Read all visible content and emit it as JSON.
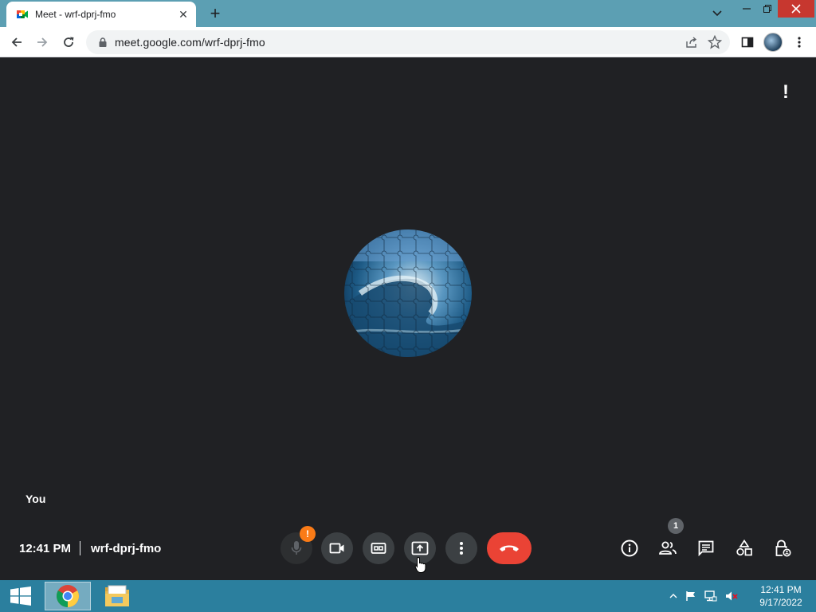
{
  "browser": {
    "tab_title": "Meet - wrf-dprj-fmo",
    "url": "meet.google.com/wrf-dprj-fmo"
  },
  "meet": {
    "participant_label": "You",
    "time": "12:41 PM",
    "meeting_code": "wrf-dprj-fmo",
    "mic_warning": "!",
    "people_count": "1",
    "colors": {
      "background": "#202124",
      "control": "#3c4043",
      "leave": "#ea4335",
      "warning": "#fa7b17"
    }
  },
  "taskbar": {
    "time": "12:41 PM",
    "date": "9/17/2022",
    "apps": [
      "chrome-icon",
      "file-explorer-icon"
    ]
  }
}
